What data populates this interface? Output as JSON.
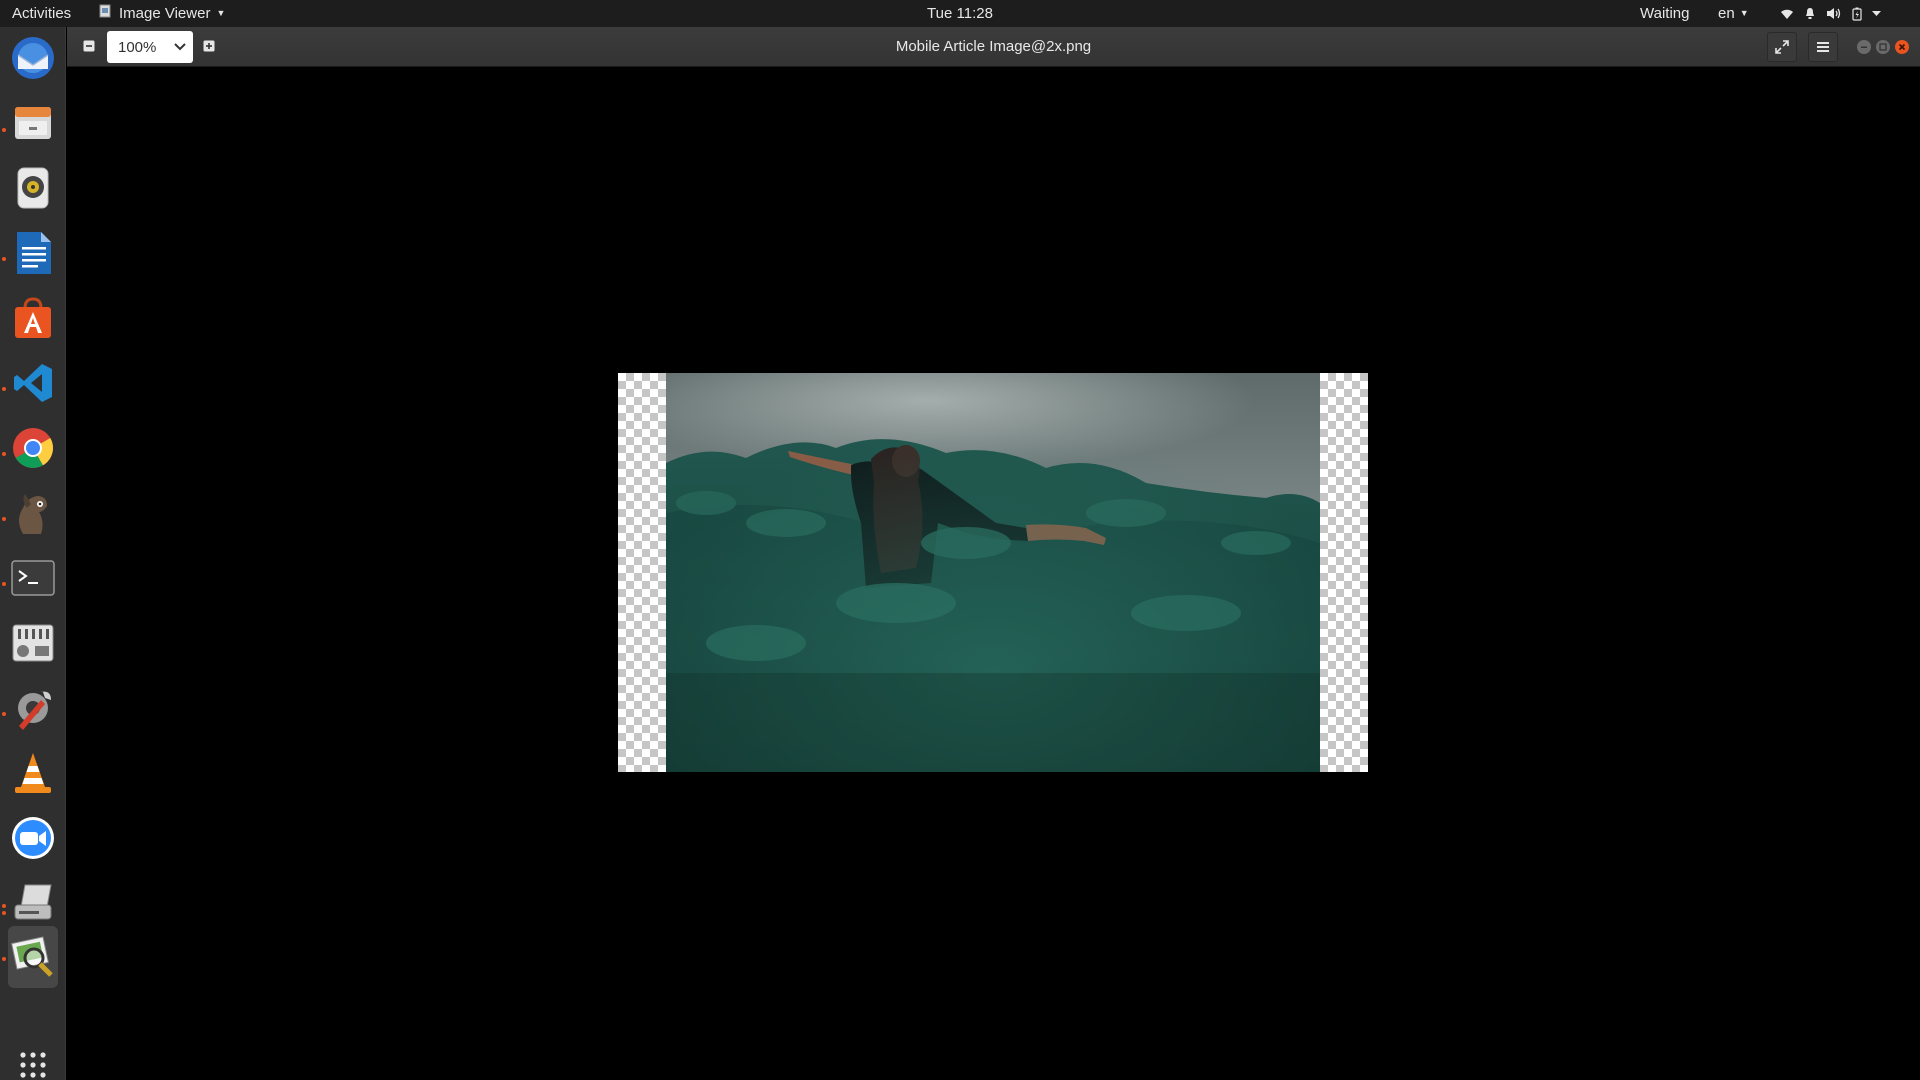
{
  "topbar": {
    "activities": "Activities",
    "app_name": "Image Viewer",
    "clock": "Tue 11:28",
    "status": "Waiting",
    "language": "en",
    "tray_icons": [
      "wifi-icon",
      "notification-bell-icon",
      "volume-icon",
      "battery-icon",
      "system-menu-caret-icon"
    ]
  },
  "dock": {
    "items": [
      {
        "name": "thunderbird-mail",
        "running": false
      },
      {
        "name": "files",
        "running": true
      },
      {
        "name": "rhythmbox",
        "running": false
      },
      {
        "name": "libreoffice-writer",
        "running": true
      },
      {
        "name": "ubuntu-software",
        "running": false
      },
      {
        "name": "visual-studio-code",
        "running": true
      },
      {
        "name": "google-chrome",
        "running": true
      },
      {
        "name": "gimp",
        "running": true
      },
      {
        "name": "terminal",
        "running": true
      },
      {
        "name": "system-settings-mixer",
        "running": false
      },
      {
        "name": "system-tools",
        "running": true
      },
      {
        "name": "vlc-media-player",
        "running": false
      },
      {
        "name": "zoom",
        "running": false
      },
      {
        "name": "scanner-utility",
        "running": true
      },
      {
        "name": "image-viewer",
        "running": true,
        "active": true
      }
    ],
    "show_apps": "show-applications"
  },
  "window": {
    "title": "Mobile Article Image@2x.png",
    "zoom": "100%"
  },
  "colors": {
    "accent": "#e95420",
    "topbar_bg": "#1d1d1d",
    "dock_bg": "#2f2f2f",
    "headerbar_bg": "#363636",
    "viewer_bg": "#000000",
    "photo_teal": "#1f5a50"
  }
}
